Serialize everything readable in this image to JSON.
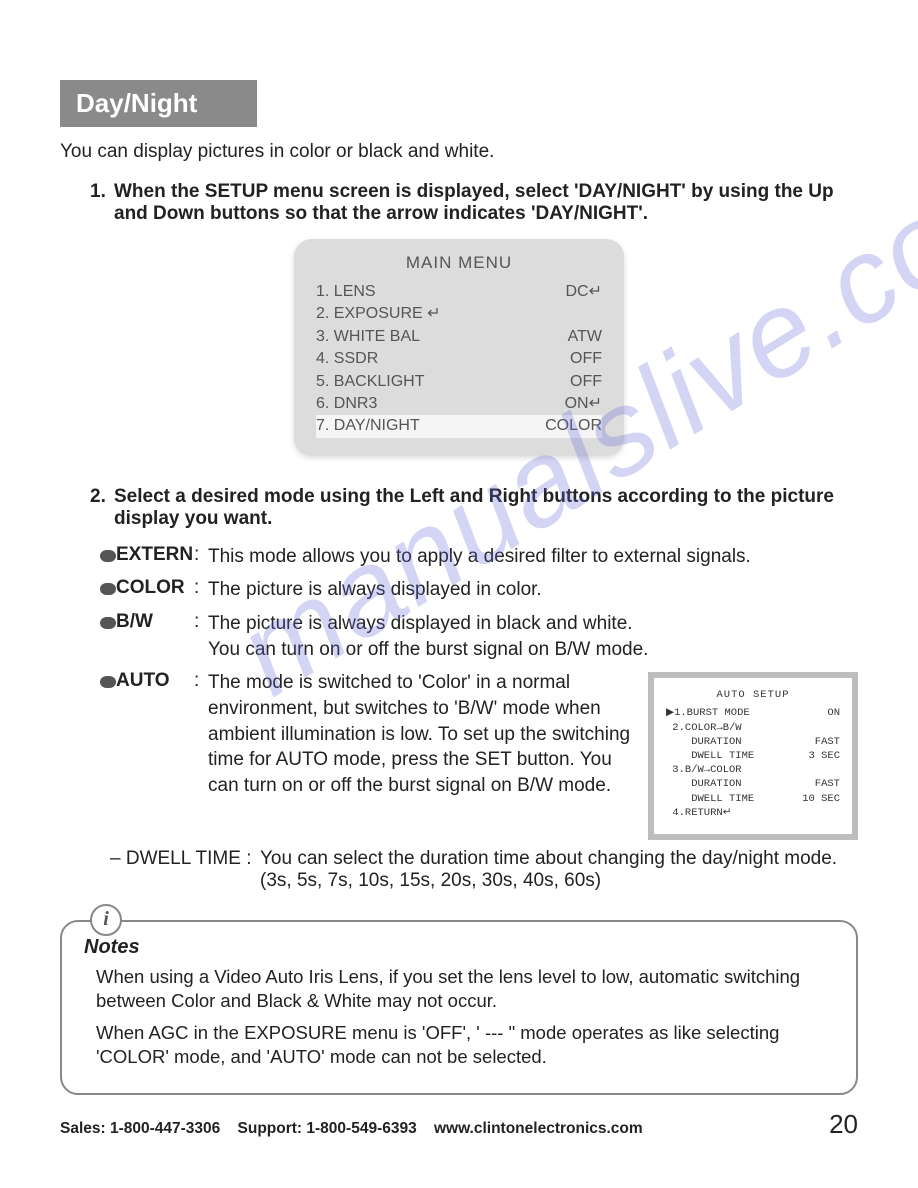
{
  "section_title": "Day/Night",
  "intro": "You can display pictures in color or black and white.",
  "step1_num": "1.",
  "step1": "When the SETUP menu screen is displayed, select 'DAY/NIGHT' by using the Up and Down buttons so that the arrow indicates 'DAY/NIGHT'.",
  "menu": {
    "title": "MAIN MENU",
    "r1l": "1. LENS",
    "r1r": "DC↵",
    "r2l": "2. EXPOSURE ↵",
    "r2r": "",
    "r3l": "3. WHITE BAL",
    "r3r": "ATW",
    "r4l": "4. SSDR",
    "r4r": "OFF",
    "r5l": "5. BACKLIGHT",
    "r5r": "OFF",
    "r6l": "6. DNR3",
    "r6r": "ON↵",
    "r7l": "7. DAY/NIGHT",
    "r7r": "COLOR"
  },
  "step2_num": "2.",
  "step2": "Select a desired mode using the Left and Right buttons according to the picture display you want.",
  "modes": {
    "extern_l": "EXTERN",
    "extern_d": "This mode allows you to apply a desired filter to external signals.",
    "color_l": "COLOR",
    "color_d": "The picture is always displayed in color.",
    "bw_l": "B/W",
    "bw_d": "The picture is always displayed in black and white.\nYou can turn on or off the burst signal on B/W mode.",
    "auto_l": "AUTO",
    "auto_d": "The mode is switched to 'Color' in a normal environment, but switches to 'B/W' mode when ambient illumination is low.  To set up the switching time for AUTO mode, press the SET button.  You can turn on or off the burst signal on B/W mode."
  },
  "colon": ":",
  "auto_setup": {
    "title": "AUTO SETUP",
    "r1l": "▶1.BURST MODE",
    "r1r": "ON",
    "r2l": " 2.COLOR→B/W",
    "r2r": "",
    "r3l": "    DURATION",
    "r3r": "FAST",
    "r4l": "    DWELL TIME",
    "r4r": "3 SEC",
    "r5l": " 3.B/W→COLOR",
    "r5r": "",
    "r6l": "    DURATION",
    "r6r": "FAST",
    "r7l": "    DWELL TIME",
    "r7r": "10 SEC",
    "r8l": " 4.RETURN↵",
    "r8r": ""
  },
  "dwell_label": "– DWELL TIME :",
  "dwell_desc": "You can select the duration time about changing the day/night mode. (3s, 5s, 7s, 10s, 15s, 20s, 30s, 40s, 60s)",
  "notes_title": "Notes",
  "notes_i": "i",
  "notes_p1": "When using a Video Auto Iris Lens, if you set the lens level to low, automatic switching between Color and Black & White may not occur.",
  "notes_p2": "When AGC in the EXPOSURE menu is 'OFF', ' --- \" mode operates as like selecting 'COLOR' mode, and 'AUTO' mode can not be selected.",
  "footer": {
    "sales": "Sales:  1-800-447-3306",
    "support": "Support:  1-800-549-6393",
    "web": "www.clintonelectronics.com",
    "page": "20"
  },
  "watermark": "manualslive.com"
}
